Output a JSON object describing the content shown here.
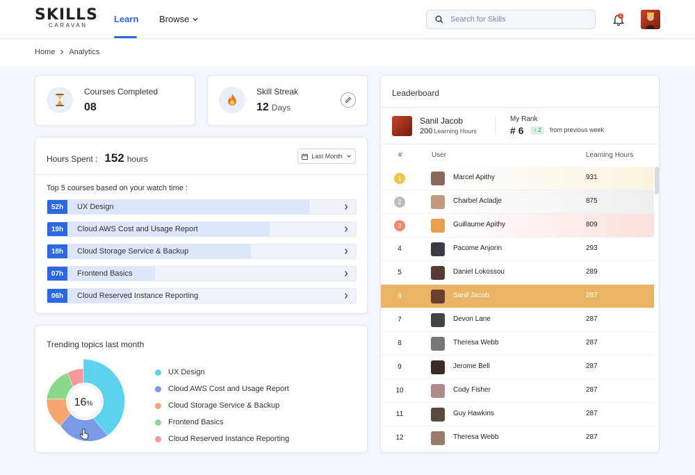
{
  "app": {
    "logo_main": "SKILLS",
    "logo_sub": "CARAVAN"
  },
  "nav": {
    "learn": "Learn",
    "browse": "Browse"
  },
  "search": {
    "placeholder": "Search for Skills"
  },
  "notifications": {
    "count": "1"
  },
  "breadcrumb": {
    "home": "Home",
    "current": "Analytics"
  },
  "stats": {
    "courses_completed": {
      "label": "Courses Completed",
      "value": "08"
    },
    "skill_streak": {
      "label": "Skill Streak",
      "value": "12",
      "unit": "Days"
    }
  },
  "hours": {
    "label": "Hours Spent :",
    "value": "152",
    "unit": "hours",
    "period": "Last Month",
    "subtitle": "Top 5 courses based on your watch time :",
    "courses": [
      {
        "hours": "52h",
        "name": "UX Design",
        "fraction": 0.85
      },
      {
        "hours": "19h",
        "name": "Cloud AWS Cost and Usage Report",
        "fraction": 0.72
      },
      {
        "hours": "18h",
        "name": "Cloud Storage Service & Backup",
        "fraction": 0.66
      },
      {
        "hours": "07h",
        "name": "Frontend Basics",
        "fraction": 0.35
      },
      {
        "hours": "06h",
        "name": "Cloud Reserved Instance Reporting",
        "fraction": 0.27
      }
    ]
  },
  "trending": {
    "title": "Trending topics last month",
    "center_value": "16",
    "center_unit": "%",
    "topics": [
      {
        "name": "UX Design",
        "color": "#5dd2ee"
      },
      {
        "name": "Cloud AWS Cost and Usage Report",
        "color": "#7b9ae6"
      },
      {
        "name": "Cloud Storage Service & Backup",
        "color": "#f7a66f"
      },
      {
        "name": "Frontend Basics",
        "color": "#88d98a"
      },
      {
        "name": "Cloud Reserved Instance Reporting",
        "color": "#f59a9a"
      }
    ]
  },
  "leaderboard": {
    "title": "Leaderboard",
    "me": {
      "name": "Sanil Jacob",
      "hours": "200",
      "hours_label": "Learning Hours",
      "rank_label": "My Rank",
      "rank": "# 6",
      "delta": "↑ 2",
      "delta_label": "from previous week"
    },
    "headers": {
      "rank": "#",
      "user": "User",
      "hours": "Learning Hours"
    },
    "rows": [
      {
        "rank": "1",
        "name": "Marcel Apithy",
        "hours": "931"
      },
      {
        "rank": "2",
        "name": "Charbel Acladje",
        "hours": "875"
      },
      {
        "rank": "3",
        "name": "Guillaume Apithy",
        "hours": "809"
      },
      {
        "rank": "4",
        "name": "Pacome Anjorin",
        "hours": "293"
      },
      {
        "rank": "5",
        "name": "Daniel Lokossou",
        "hours": "289"
      },
      {
        "rank": "6",
        "name": "Sanil Jacob",
        "hours": "287"
      },
      {
        "rank": "7",
        "name": "Devon Lane",
        "hours": "287"
      },
      {
        "rank": "8",
        "name": "Theresa Webb",
        "hours": "287"
      },
      {
        "rank": "9",
        "name": "Jerome Bell",
        "hours": "287"
      },
      {
        "rank": "10",
        "name": "Cody Fisher",
        "hours": "287"
      },
      {
        "rank": "11",
        "name": "Guy Hawkins",
        "hours": "287"
      },
      {
        "rank": "12",
        "name": "Theresa Webb",
        "hours": "287"
      }
    ]
  }
}
